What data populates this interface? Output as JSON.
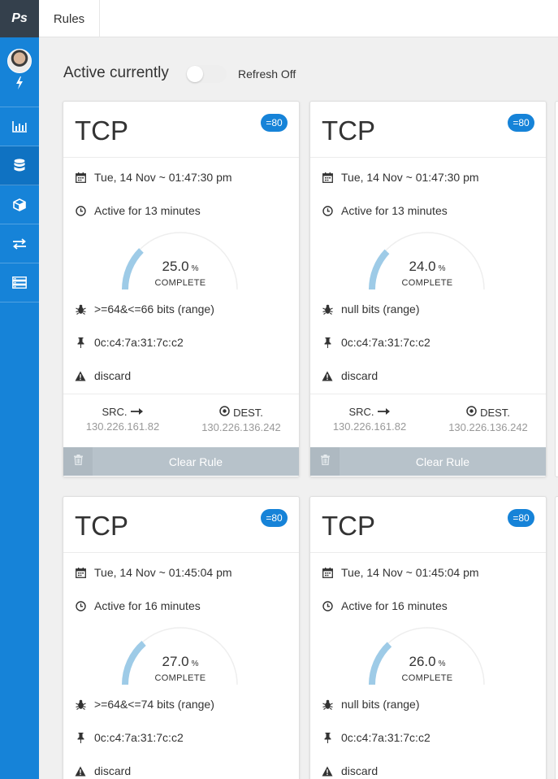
{
  "app": {
    "logo_text": "Ps"
  },
  "sidebar": {
    "profile": {
      "avatar": "user-avatar",
      "icon": "bolt-icon"
    },
    "items": [
      {
        "icon": "bar-chart-icon"
      },
      {
        "icon": "database-icon",
        "active": true
      },
      {
        "icon": "cube-icon"
      },
      {
        "icon": "exchange-arrows-icon"
      },
      {
        "icon": "server-list-icon"
      }
    ]
  },
  "topbar": {
    "tab_label": "Rules"
  },
  "header": {
    "title": "Active currently",
    "refresh_label": "Refresh Off",
    "refresh_on": false
  },
  "colors": {
    "sidebar": "#1683d8",
    "logo_bg": "#34404c",
    "badge": "#1683d8",
    "gauge_arc": "#9ecbe7",
    "footer": "#b7c2ca"
  },
  "cards": [
    {
      "protocol": "TCP",
      "port_badge": "=80",
      "date": "Tue, 14 Nov ~ 01:47:30 pm",
      "duration": "Active for 13 minutes",
      "progress_value": "25.0",
      "progress_unit": "%",
      "progress_label": "COMPLETE",
      "progress": 0.25,
      "bits": ">=64&<=66 bits (range)",
      "mac": "0c:c4:7a:31:7c:c2",
      "action": "discard",
      "src_label": "SRC.",
      "src_ip": "130.226.161.82",
      "dest_label": "DEST.",
      "dest_ip": "130.226.136.242",
      "clear_label": "Clear Rule"
    },
    {
      "protocol": "TCP",
      "port_badge": "=80",
      "date": "Tue, 14 Nov ~ 01:47:30 pm",
      "duration": "Active for 13 minutes",
      "progress_value": "24.0",
      "progress_unit": "%",
      "progress_label": "COMPLETE",
      "progress": 0.24,
      "bits": "null bits (range)",
      "mac": "0c:c4:7a:31:7c:c2",
      "action": "discard",
      "src_label": "SRC.",
      "src_ip": "130.226.161.82",
      "dest_label": "DEST.",
      "dest_ip": "130.226.136.242",
      "clear_label": "Clear Rule"
    },
    {
      "protocol": "TCP",
      "port_badge": "=80",
      "date": "Tue, 14 Nov ~ 01:45:04 pm",
      "duration": "Active for 16 minutes",
      "progress_value": "27.0",
      "progress_unit": "%",
      "progress_label": "COMPLETE",
      "progress": 0.27,
      "bits": ">=64&<=74 bits (range)",
      "mac": "0c:c4:7a:31:7c:c2",
      "action": "discard"
    },
    {
      "protocol": "TCP",
      "port_badge": "=80",
      "date": "Tue, 14 Nov ~ 01:45:04 pm",
      "duration": "Active for 16 minutes",
      "progress_value": "26.0",
      "progress_unit": "%",
      "progress_label": "COMPLETE",
      "progress": 0.26,
      "bits": "null bits (range)",
      "mac": "0c:c4:7a:31:7c:c2",
      "action": "discard"
    }
  ]
}
